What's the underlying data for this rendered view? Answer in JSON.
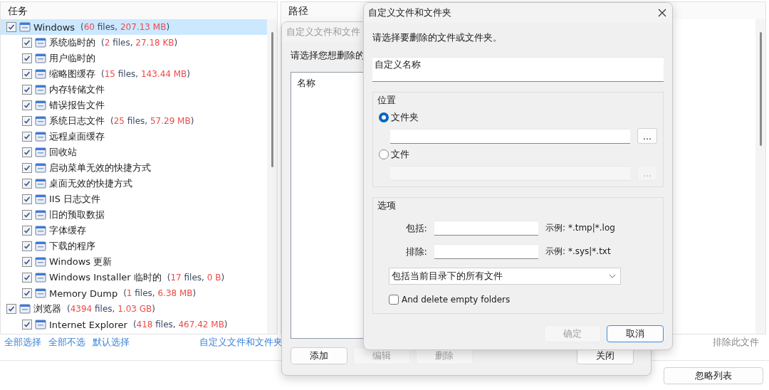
{
  "tasks_panel": {
    "header": "任务",
    "tree": [
      {
        "label": "Windows",
        "checked": true,
        "selected": true,
        "detail": [
          {
            "text": "(",
            "kind": "plain"
          },
          {
            "text": "60",
            "kind": "number"
          },
          {
            "text": " files, ",
            "kind": "plain"
          },
          {
            "text": "207.13 MB",
            "kind": "number"
          },
          {
            "text": ")",
            "kind": "plain"
          }
        ],
        "children": [
          {
            "label": "系统临时的",
            "checked": true,
            "selected": false,
            "detail": [
              {
                "text": "(",
                "kind": "plain"
              },
              {
                "text": "2",
                "kind": "number"
              },
              {
                "text": " files, ",
                "kind": "plain"
              },
              {
                "text": "27.18 KB",
                "kind": "number"
              },
              {
                "text": ")",
                "kind": "plain"
              }
            ]
          },
          {
            "label": "用户临时的",
            "checked": true,
            "selected": false
          },
          {
            "label": "缩略图缓存",
            "checked": true,
            "selected": false,
            "detail": [
              {
                "text": "(",
                "kind": "plain"
              },
              {
                "text": "15",
                "kind": "number"
              },
              {
                "text": " files, ",
                "kind": "plain"
              },
              {
                "text": "143.44 MB",
                "kind": "number"
              },
              {
                "text": ")",
                "kind": "plain"
              }
            ]
          },
          {
            "label": "内存转储文件",
            "checked": true,
            "selected": false
          },
          {
            "label": "错误报告文件",
            "checked": true,
            "selected": false
          },
          {
            "label": "系统日志文件",
            "checked": true,
            "selected": false,
            "detail": [
              {
                "text": "(",
                "kind": "plain"
              },
              {
                "text": "25",
                "kind": "number"
              },
              {
                "text": " files, ",
                "kind": "plain"
              },
              {
                "text": "57.29 MB",
                "kind": "number"
              },
              {
                "text": ")",
                "kind": "plain"
              }
            ]
          },
          {
            "label": "远程桌面缓存",
            "checked": true,
            "selected": false
          },
          {
            "label": "回收站",
            "checked": true,
            "selected": false
          },
          {
            "label": "启动菜单无效的快捷方式",
            "checked": true,
            "selected": false
          },
          {
            "label": "桌面无效的快捷方式",
            "checked": true,
            "selected": false
          },
          {
            "label": "IIS 日志文件",
            "checked": true,
            "selected": false
          },
          {
            "label": "旧的预取数据",
            "checked": true,
            "selected": false
          },
          {
            "label": "字体缓存",
            "checked": true,
            "selected": false
          },
          {
            "label": "下载的程序",
            "checked": true,
            "selected": false
          },
          {
            "label": "Windows 更新",
            "checked": true,
            "selected": false
          },
          {
            "label": "Windows Installer 临时的",
            "checked": true,
            "selected": false,
            "detail": [
              {
                "text": "(",
                "kind": "plain"
              },
              {
                "text": "17",
                "kind": "number"
              },
              {
                "text": " files, ",
                "kind": "plain"
              },
              {
                "text": "0 B",
                "kind": "number"
              },
              {
                "text": ")",
                "kind": "plain"
              }
            ]
          },
          {
            "label": "Memory Dump",
            "checked": true,
            "selected": false,
            "detail": [
              {
                "text": "(",
                "kind": "plain"
              },
              {
                "text": "1",
                "kind": "number"
              },
              {
                "text": " files, ",
                "kind": "plain"
              },
              {
                "text": "6.38 MB",
                "kind": "number"
              },
              {
                "text": ")",
                "kind": "plain"
              }
            ]
          }
        ]
      },
      {
        "label": "浏览器",
        "checked": true,
        "selected": false,
        "detail": [
          {
            "text": "(",
            "kind": "plain"
          },
          {
            "text": "4394",
            "kind": "number"
          },
          {
            "text": " files, ",
            "kind": "plain"
          },
          {
            "text": "1.03 GB",
            "kind": "number"
          },
          {
            "text": ")",
            "kind": "plain"
          }
        ],
        "children": [
          {
            "label": "Internet Explorer",
            "checked": true,
            "selected": false,
            "detail": [
              {
                "text": "(",
                "kind": "plain"
              },
              {
                "text": "418",
                "kind": "number"
              },
              {
                "text": " files, ",
                "kind": "plain"
              },
              {
                "text": "467.42 MB",
                "kind": "number"
              },
              {
                "text": ")",
                "kind": "plain"
              }
            ]
          }
        ]
      }
    ],
    "links": [
      "全部选择",
      "全部不选",
      "默认选择"
    ],
    "custom_link": "自定义文件和文件夹"
  },
  "path_panel": {
    "header": "路径",
    "exclude_button": {
      "label": "排除此文件",
      "disabled": true
    },
    "ignore_button": {
      "label": "忽略列表",
      "disabled": false
    }
  },
  "list_dialog": {
    "title": "自定义文件和文件",
    "active": false,
    "prompt": "请选择您想删除的",
    "list_header": "名称",
    "buttons": [
      {
        "label": "添加",
        "disabled": false
      },
      {
        "label": "编辑",
        "disabled": true
      },
      {
        "label": "删除",
        "disabled": true
      }
    ],
    "close_button": {
      "label": "关闭",
      "disabled": false
    }
  },
  "edit_dialog": {
    "title": "自定义文件和文件夹",
    "active": true,
    "prompt": "请选择要删除的文件或文件夹。",
    "name_field": {
      "value": "自定义名称"
    },
    "location": {
      "title": "位置",
      "options": [
        {
          "label": "文件夹",
          "selected": true,
          "disabled": false,
          "browse": "..."
        },
        {
          "label": "文件",
          "selected": false,
          "disabled": true,
          "browse": "..."
        }
      ]
    },
    "filters": {
      "title": "选项",
      "rows": [
        {
          "label": "包括:",
          "example_label": "示例:",
          "example": "*.tmp|*.log"
        },
        {
          "label": "排除:",
          "example_label": "示例:",
          "example": "*.sys|*.txt"
        }
      ],
      "scope": "包括当前目录下的所有文件",
      "delete_empty": {
        "label": "And delete empty folders",
        "checked": false
      }
    },
    "buttons": [
      {
        "label": "确定",
        "disabled": true,
        "default": false
      },
      {
        "label": "取消",
        "disabled": false,
        "default": true
      }
    ]
  }
}
